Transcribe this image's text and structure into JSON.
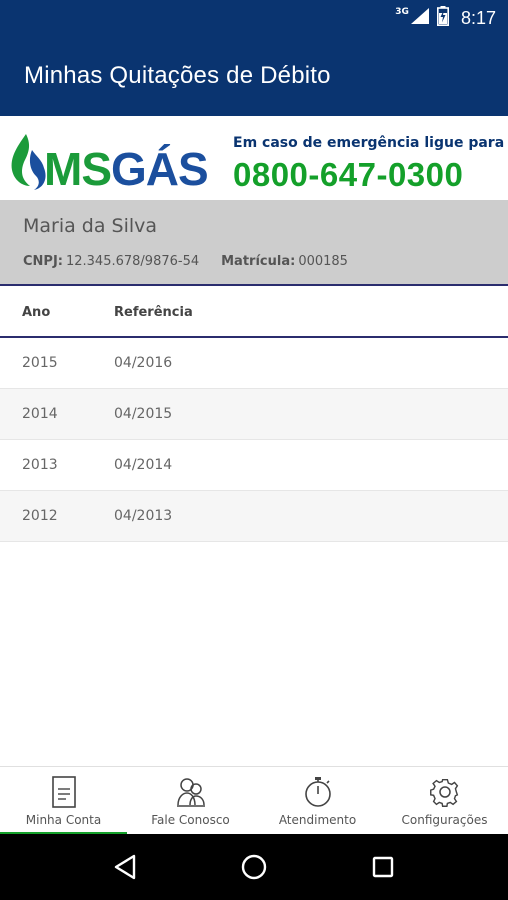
{
  "status_bar": {
    "network": "3G",
    "time": "8:17"
  },
  "app_bar": {
    "title": "Minhas Quitações de Débito"
  },
  "banner": {
    "logo_ms": "MS",
    "logo_gas": "GÁS",
    "emergency_label": "Em caso de emergência ligue para",
    "emergency_phone": "0800-647-0300"
  },
  "client": {
    "name": "Maria da Silva",
    "cnpj_label": "CNPJ:",
    "cnpj_value": "12.345.678/9876-54",
    "matricula_label": "Matrícula:",
    "matricula_value": "000185"
  },
  "table": {
    "headers": {
      "ano": "Ano",
      "referencia": "Referência"
    },
    "rows": [
      {
        "ano": "2015",
        "referencia": "04/2016"
      },
      {
        "ano": "2014",
        "referencia": "04/2015"
      },
      {
        "ano": "2013",
        "referencia": "04/2014"
      },
      {
        "ano": "2012",
        "referencia": "04/2013"
      }
    ]
  },
  "tabs": [
    {
      "label": "Minha Conta",
      "icon": "document-icon",
      "active": true
    },
    {
      "label": "Fale Conosco",
      "icon": "people-icon",
      "active": false
    },
    {
      "label": "Atendimento",
      "icon": "stopwatch-icon",
      "active": false
    },
    {
      "label": "Configurações",
      "icon": "gear-icon",
      "active": false
    }
  ],
  "colors": {
    "primary": "#0a3470",
    "accent_green": "#14a02a",
    "logo_blue": "#1b4f9e",
    "client_bg": "#cdcdcd"
  }
}
